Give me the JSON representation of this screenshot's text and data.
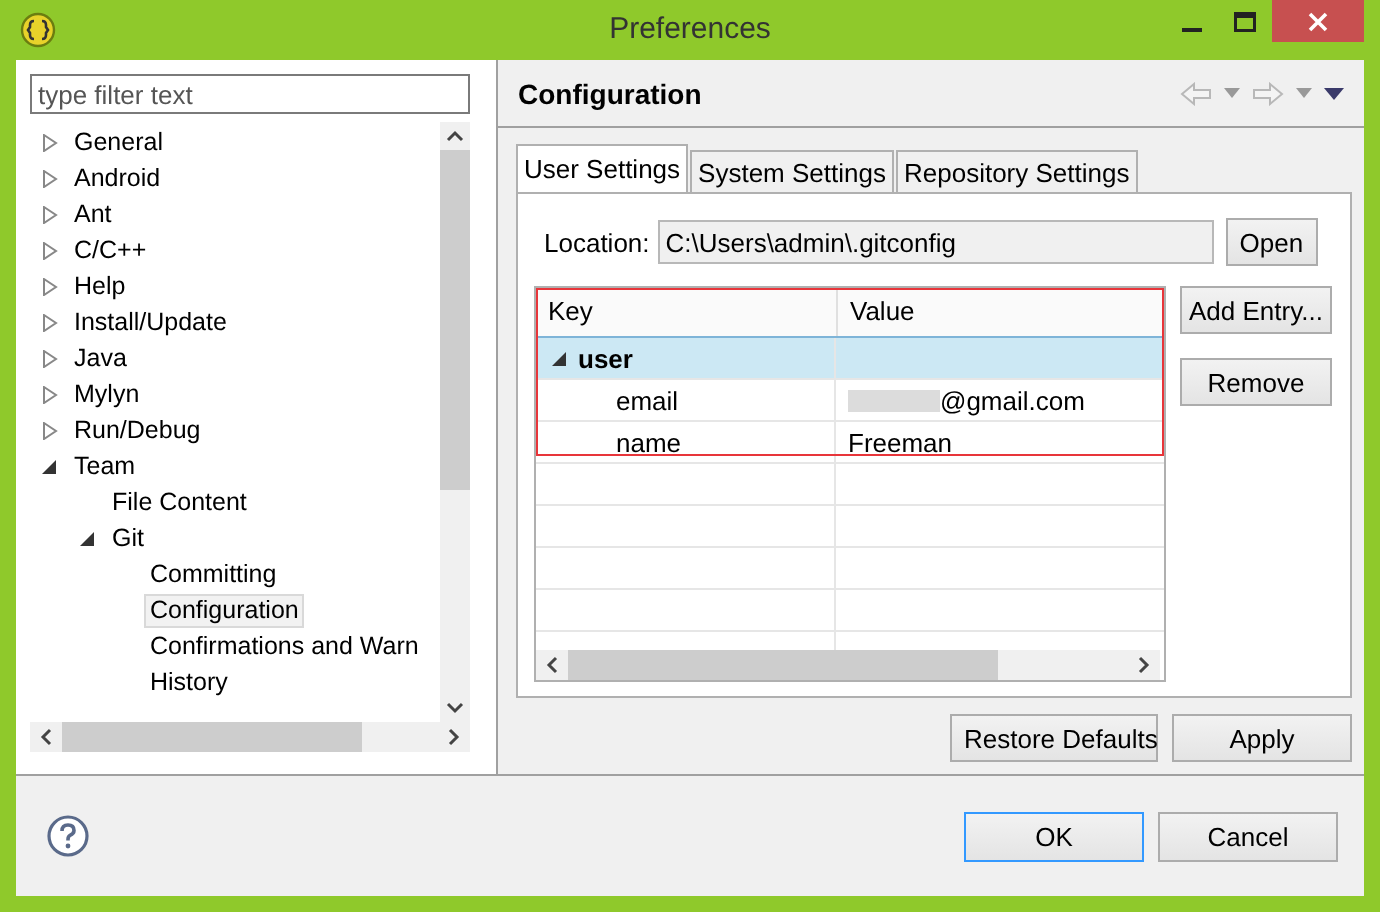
{
  "window": {
    "title": "Preferences"
  },
  "filter": {
    "placeholder": "type filter text"
  },
  "tree": [
    {
      "label": "General",
      "expanded": false,
      "selected": false
    },
    {
      "label": "Android",
      "expanded": false,
      "selected": false
    },
    {
      "label": "Ant",
      "expanded": false,
      "selected": false
    },
    {
      "label": "C/C++",
      "expanded": false,
      "selected": false
    },
    {
      "label": "Help",
      "expanded": false,
      "selected": false
    },
    {
      "label": "Install/Update",
      "expanded": false,
      "selected": false
    },
    {
      "label": "Java",
      "expanded": false,
      "selected": false
    },
    {
      "label": "Mylyn",
      "expanded": false,
      "selected": false
    },
    {
      "label": "Run/Debug",
      "expanded": false,
      "selected": false
    },
    {
      "label": "Team",
      "expanded": true,
      "selected": false,
      "children": [
        {
          "label": "File Content",
          "selected": false
        },
        {
          "label": "Git",
          "expanded": true,
          "selected": false,
          "children": [
            {
              "label": "Committing",
              "selected": false
            },
            {
              "label": "Configuration",
              "selected": true
            },
            {
              "label": "Confirmations and Warn",
              "selected": false
            },
            {
              "label": "History",
              "selected": false
            }
          ]
        }
      ]
    }
  ],
  "page": {
    "title": "Configuration"
  },
  "tabs": [
    {
      "label": "User Settings",
      "selected": true
    },
    {
      "label": "System Settings",
      "selected": false
    },
    {
      "label": "Repository Settings",
      "selected": false
    }
  ],
  "location": {
    "label": "Location:",
    "value": "C:\\Users\\admin\\.gitconfig",
    "button": "Open"
  },
  "table": {
    "columns": [
      "Key",
      "Value"
    ],
    "rows": [
      {
        "key": "user",
        "expanded": true,
        "selected": true,
        "children": [
          {
            "key": "email",
            "value": "@gmail.com",
            "redacted": true,
            "selected": false
          },
          {
            "key": "name",
            "value": "Freeman",
            "selected": false
          }
        ]
      }
    ]
  },
  "side_buttons": [
    "Add Entry...",
    "Remove"
  ],
  "page_buttons": [
    "Restore Defaults",
    "Apply"
  ],
  "dialog_buttons": [
    {
      "label": "OK",
      "default": true
    },
    {
      "label": "Cancel",
      "default": false
    }
  ]
}
